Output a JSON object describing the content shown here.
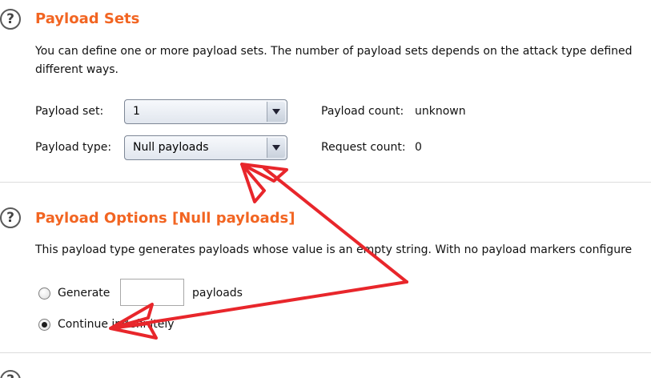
{
  "payload_sets": {
    "title": "Payload Sets",
    "description_line1": "You can define one or more payload sets. The number of payload sets depends on the attack type defined",
    "description_line2": "different ways.",
    "payload_set_label": "Payload set:",
    "payload_set_value": "1",
    "payload_type_label": "Payload type:",
    "payload_type_value": "Null payloads",
    "payload_count_label": "Payload count:",
    "payload_count_value": "unknown",
    "request_count_label": "Request count:",
    "request_count_value": "0"
  },
  "payload_options": {
    "title": "Payload Options [Null payloads]",
    "description": "This payload type generates payloads whose value is an empty string. With no payload markers configure",
    "generate_label": "Generate",
    "generate_suffix": "payloads",
    "generate_count": "",
    "continue_label": "Continue indefinitely",
    "selected_option": "continue"
  },
  "help_icon": {
    "glyph": "?",
    "icon": "question-mark-icon"
  },
  "colors": {
    "section_title": "#f26522",
    "annotation_arrow": "#e8262b"
  }
}
